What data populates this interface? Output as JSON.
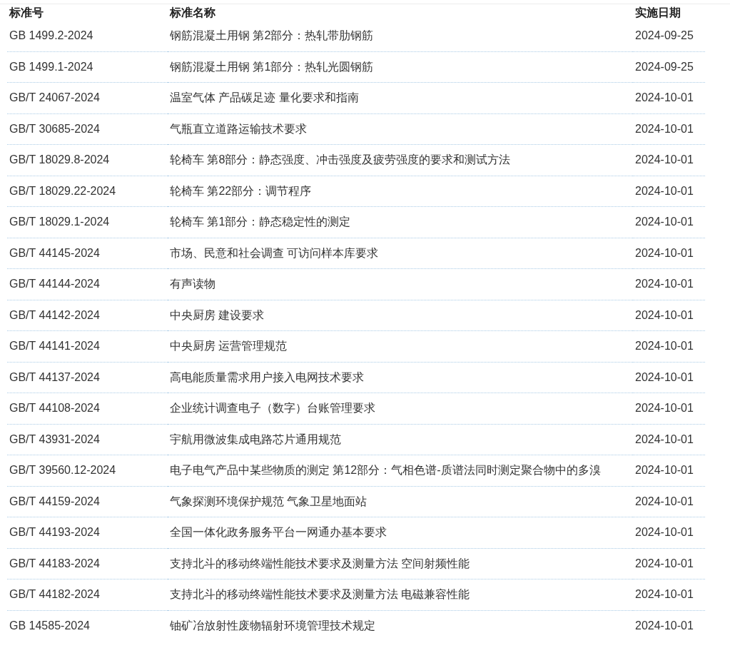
{
  "table": {
    "columns": [
      "标准号",
      "标准名称",
      "实施日期"
    ],
    "rows": [
      {
        "code": "GB 1499.2-2024",
        "name": "钢筋混凝土用钢 第2部分：热轧带肋钢筋",
        "date": "2024-09-25"
      },
      {
        "code": "GB 1499.1-2024",
        "name": "钢筋混凝土用钢 第1部分：热轧光圆钢筋",
        "date": "2024-09-25"
      },
      {
        "code": "GB/T 24067-2024",
        "name": "温室气体 产品碳足迹 量化要求和指南",
        "date": "2024-10-01"
      },
      {
        "code": "GB/T 30685-2024",
        "name": "气瓶直立道路运输技术要求",
        "date": "2024-10-01"
      },
      {
        "code": "GB/T 18029.8-2024",
        "name": "轮椅车 第8部分：静态强度、冲击强度及疲劳强度的要求和测试方法",
        "date": "2024-10-01"
      },
      {
        "code": "GB/T 18029.22-2024",
        "name": "轮椅车 第22部分：调节程序",
        "date": "2024-10-01"
      },
      {
        "code": "GB/T 18029.1-2024",
        "name": "轮椅车 第1部分：静态稳定性的测定",
        "date": "2024-10-01"
      },
      {
        "code": "GB/T 44145-2024",
        "name": "市场、民意和社会调查 可访问样本库要求",
        "date": "2024-10-01"
      },
      {
        "code": "GB/T 44144-2024",
        "name": "有声读物",
        "date": "2024-10-01"
      },
      {
        "code": "GB/T 44142-2024",
        "name": "中央厨房 建设要求",
        "date": "2024-10-01"
      },
      {
        "code": "GB/T 44141-2024",
        "name": "中央厨房 运营管理规范",
        "date": "2024-10-01"
      },
      {
        "code": "GB/T 44137-2024",
        "name": "高电能质量需求用户接入电网技术要求",
        "date": "2024-10-01"
      },
      {
        "code": "GB/T 44108-2024",
        "name": "企业统计调查电子（数字）台账管理要求",
        "date": "2024-10-01"
      },
      {
        "code": "GB/T 43931-2024",
        "name": "宇航用微波集成电路芯片通用规范",
        "date": "2024-10-01"
      },
      {
        "code": "GB/T 39560.12-2024",
        "name": "电子电气产品中某些物质的测定 第12部分：气相色谱-质谱法同时测定聚合物中的多溴",
        "date": "2024-10-01"
      },
      {
        "code": "GB/T 44159-2024",
        "name": "气象探测环境保护规范 气象卫星地面站",
        "date": "2024-10-01"
      },
      {
        "code": "GB/T 44193-2024",
        "name": "全国一体化政务服务平台一网通办基本要求",
        "date": "2024-10-01"
      },
      {
        "code": "GB/T 44183-2024",
        "name": "支持北斗的移动终端性能技术要求及测量方法 空间射频性能",
        "date": "2024-10-01"
      },
      {
        "code": "GB/T 44182-2024",
        "name": "支持北斗的移动终端性能技术要求及测量方法 电磁兼容性能",
        "date": "2024-10-01"
      },
      {
        "code": "GB 14585-2024",
        "name": "铀矿冶放射性废物辐射环境管理技术规定",
        "date": "2024-10-01"
      }
    ]
  }
}
